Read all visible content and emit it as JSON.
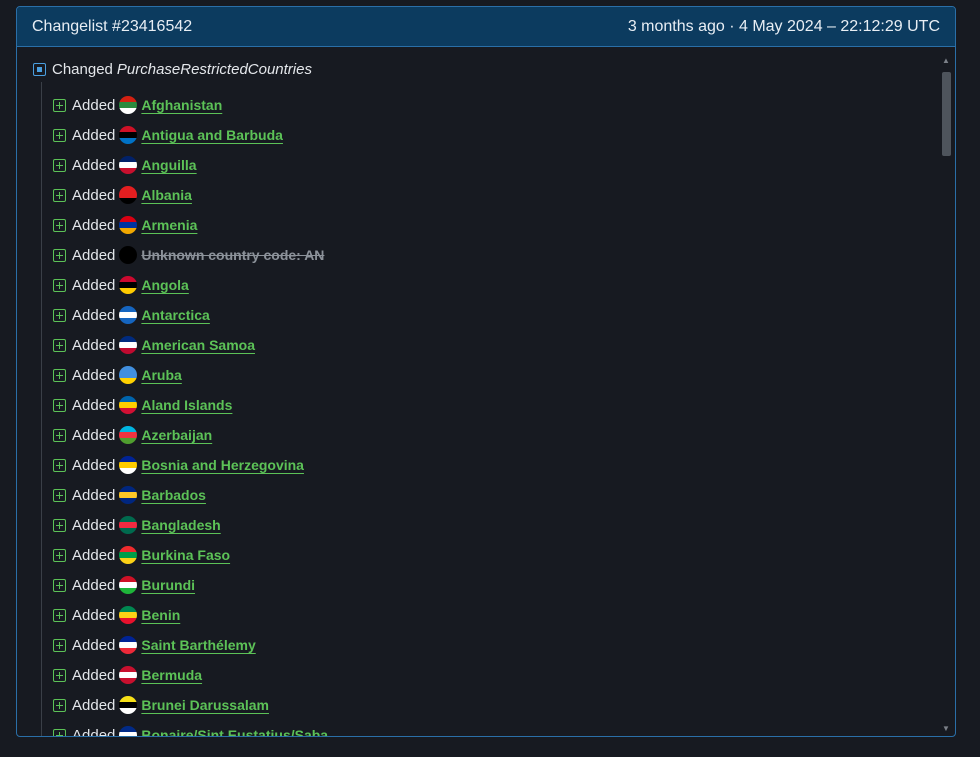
{
  "header": {
    "title": "Changelist #23416542",
    "timestamp": "3 months ago · 4 May 2024 – 22:12:29 UTC"
  },
  "root": {
    "action": "Changed",
    "key": "PurchaseRestrictedCountries"
  },
  "items": [
    {
      "action": "Added",
      "name": "Afghanistan",
      "flag": [
        "#d32011",
        "#2b8a3e",
        "#ffffff"
      ],
      "unknown": false
    },
    {
      "action": "Added",
      "name": "Antigua and Barbuda",
      "flag": [
        "#ce1126",
        "#000000",
        "#0072c6"
      ],
      "unknown": false
    },
    {
      "action": "Added",
      "name": "Anguilla",
      "flag": [
        "#012169",
        "#ffffff",
        "#c8102e"
      ],
      "unknown": false
    },
    {
      "action": "Added",
      "name": "Albania",
      "flag": [
        "#e41e20",
        "#e41e20",
        "#000000"
      ],
      "unknown": false
    },
    {
      "action": "Added",
      "name": "Armenia",
      "flag": [
        "#d90012",
        "#0033a0",
        "#f2a800"
      ],
      "unknown": false
    },
    {
      "action": "Added",
      "name": "Unknown country code: AN",
      "flag": [
        "#000000",
        "#000000",
        "#000000"
      ],
      "unknown": true
    },
    {
      "action": "Added",
      "name": "Angola",
      "flag": [
        "#cc092f",
        "#000000",
        "#ffcb00"
      ],
      "unknown": false
    },
    {
      "action": "Added",
      "name": "Antarctica",
      "flag": [
        "#1565c0",
        "#ffffff",
        "#1565c0"
      ],
      "unknown": false
    },
    {
      "action": "Added",
      "name": "American Samoa",
      "flag": [
        "#002b7f",
        "#ffffff",
        "#bf0a30"
      ],
      "unknown": false
    },
    {
      "action": "Added",
      "name": "Aruba",
      "flag": [
        "#418fde",
        "#418fde",
        "#ffd100"
      ],
      "unknown": false
    },
    {
      "action": "Added",
      "name": "Aland Islands",
      "flag": [
        "#0064ad",
        "#ffce00",
        "#d21034"
      ],
      "unknown": false
    },
    {
      "action": "Added",
      "name": "Azerbaijan",
      "flag": [
        "#00b5e2",
        "#ef3340",
        "#509e2f"
      ],
      "unknown": false
    },
    {
      "action": "Added",
      "name": "Bosnia and Herzegovina",
      "flag": [
        "#002395",
        "#fecb00",
        "#ffffff"
      ],
      "unknown": false
    },
    {
      "action": "Added",
      "name": "Barbados",
      "flag": [
        "#00267f",
        "#ffc726",
        "#00267f"
      ],
      "unknown": false
    },
    {
      "action": "Added",
      "name": "Bangladesh",
      "flag": [
        "#006a4e",
        "#f42a41",
        "#006a4e"
      ],
      "unknown": false
    },
    {
      "action": "Added",
      "name": "Burkina Faso",
      "flag": [
        "#ef2b2d",
        "#009e49",
        "#fcd116"
      ],
      "unknown": false
    },
    {
      "action": "Added",
      "name": "Burundi",
      "flag": [
        "#ce1126",
        "#ffffff",
        "#1eb53a"
      ],
      "unknown": false
    },
    {
      "action": "Added",
      "name": "Benin",
      "flag": [
        "#008751",
        "#fcd116",
        "#e8112d"
      ],
      "unknown": false
    },
    {
      "action": "Added",
      "name": "Saint Barthélemy",
      "flag": [
        "#002395",
        "#ffffff",
        "#ed2939"
      ],
      "unknown": false
    },
    {
      "action": "Added",
      "name": "Bermuda",
      "flag": [
        "#c8102e",
        "#ffffff",
        "#c8102e"
      ],
      "unknown": false
    },
    {
      "action": "Added",
      "name": "Brunei Darussalam",
      "flag": [
        "#f7e017",
        "#000000",
        "#ffffff"
      ],
      "unknown": false
    },
    {
      "action": "Added",
      "name": "Bonaire/Sint Eustatius/Saba",
      "flag": [
        "#012a87",
        "#ffffff",
        "#f9e814"
      ],
      "unknown": false
    }
  ]
}
